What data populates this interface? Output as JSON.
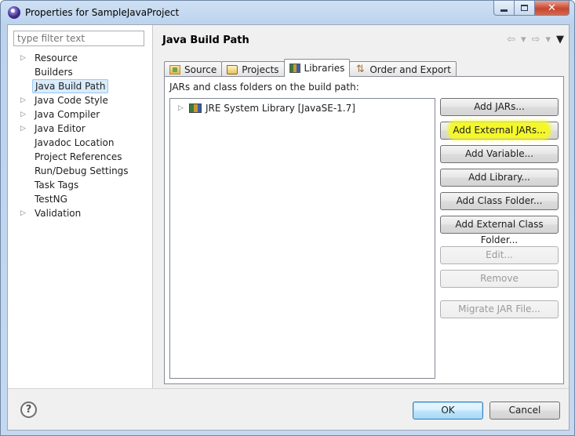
{
  "window": {
    "title": "Properties for SampleJavaProject"
  },
  "filter": {
    "placeholder": "type filter text"
  },
  "tree": {
    "items": [
      {
        "label": "Resource",
        "expandable": true
      },
      {
        "label": "Builders",
        "expandable": false
      },
      {
        "label": "Java Build Path",
        "expandable": false,
        "selected": true
      },
      {
        "label": "Java Code Style",
        "expandable": true
      },
      {
        "label": "Java Compiler",
        "expandable": true
      },
      {
        "label": "Java Editor",
        "expandable": true
      },
      {
        "label": "Javadoc Location",
        "expandable": false
      },
      {
        "label": "Project References",
        "expandable": false
      },
      {
        "label": "Run/Debug Settings",
        "expandable": false
      },
      {
        "label": "Task Tags",
        "expandable": false
      },
      {
        "label": "TestNG",
        "expandable": false
      },
      {
        "label": "Validation",
        "expandable": true
      }
    ]
  },
  "page": {
    "title": "Java Build Path",
    "tabs": [
      {
        "label": "Source",
        "icon": "source-folder-icon"
      },
      {
        "label": "Projects",
        "icon": "folder-icon"
      },
      {
        "label": "Libraries",
        "icon": "library-icon",
        "active": true
      },
      {
        "label": "Order and Export",
        "icon": "order-export-icon"
      }
    ],
    "panel_label": "JARs and class folders on the build path:",
    "libraries": [
      {
        "label": "JRE System Library [JavaSE-1.7]"
      }
    ],
    "buttons": {
      "add_jars": "Add JARs...",
      "add_external_jars": "Add External JARs...",
      "add_variable": "Add Variable...",
      "add_library": "Add Library...",
      "add_class_folder": "Add Class Folder...",
      "add_external_class_folder": "Add External Class Folder...",
      "edit": "Edit...",
      "remove": "Remove",
      "migrate_jar": "Migrate JAR File..."
    }
  },
  "dialog": {
    "ok": "OK",
    "cancel": "Cancel",
    "help": "?"
  },
  "colors": {
    "highlight": "#f4f82a",
    "selection": "#d9ebfc"
  }
}
